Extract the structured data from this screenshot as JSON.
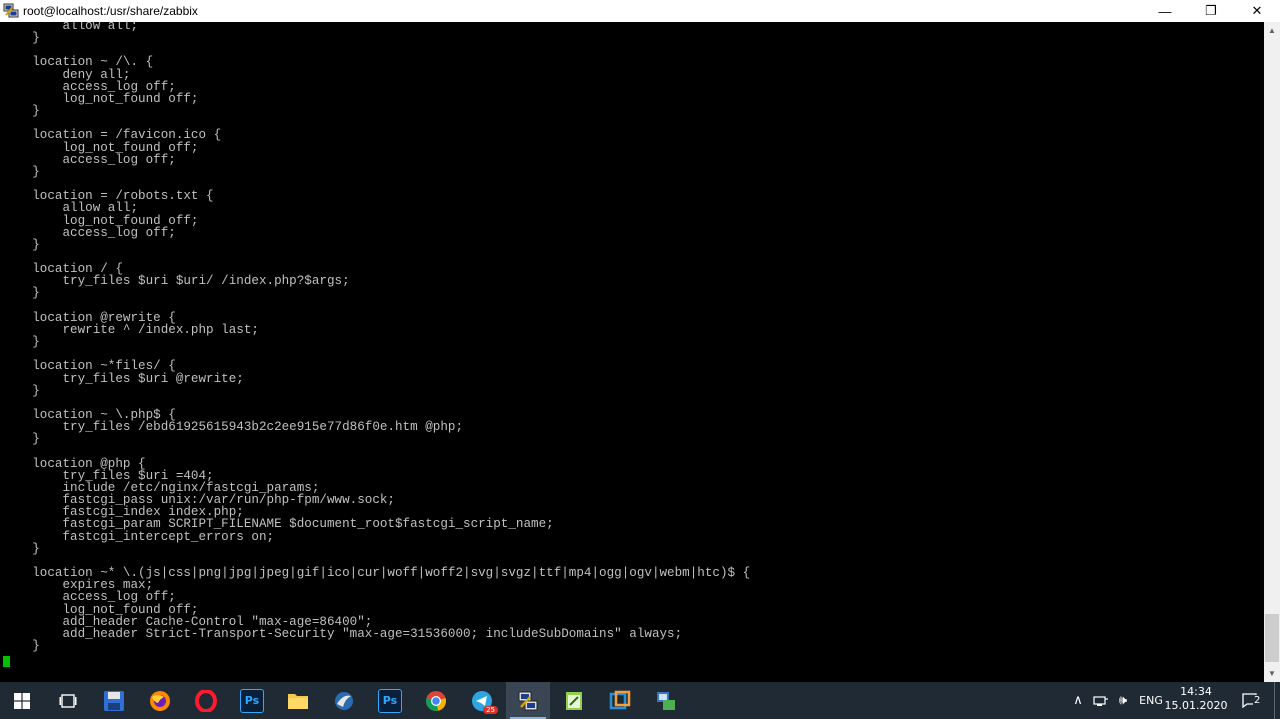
{
  "window": {
    "title": "root@localhost:/usr/share/zabbix",
    "minimize_glyph": "—",
    "maximize_glyph": "❐",
    "close_glyph": "✕"
  },
  "terminal": {
    "content": "        allow all;\n    }\n\n    location ~ /\\. {\n        deny all;\n        access_log off;\n        log_not_found off;\n    }\n\n    location = /favicon.ico {\n        log_not_found off;\n        access_log off;\n    }\n\n    location = /robots.txt {\n        allow all;\n        log_not_found off;\n        access_log off;\n    }\n\n    location / {\n        try_files $uri $uri/ /index.php?$args;\n    }\n\n    location @rewrite {\n        rewrite ^ /index.php last;\n    }\n\n    location ~*files/ {\n        try_files $uri @rewrite;\n    }\n\n    location ~ \\.php$ {\n        try_files /ebd61925615943b2c2ee915e77d86f0e.htm @php;\n    }\n\n    location @php {\n        try_files $uri =404;\n        include /etc/nginx/fastcgi_params;\n        fastcgi_pass unix:/var/run/php-fpm/www.sock;\n        fastcgi_index index.php;\n        fastcgi_param SCRIPT_FILENAME $document_root$fastcgi_script_name;\n        fastcgi_intercept_errors on;\n    }\n\n    location ~* \\.(js|css|png|jpg|jpeg|gif|ico|cur|woff|woff2|svg|svgz|ttf|mp4|ogg|ogv|webm|htc)$ {\n        expires max;\n        access_log off;\n        log_not_found off;\n        add_header Cache-Control \"max-age=86400\";\n        add_header Strict-Transport-Security \"max-age=31536000; includeSubDomains\" always;\n    }\n",
    "text_color": "#c0c0c0",
    "cursor_color": "#00c000"
  },
  "scrollbar": {
    "up_glyph": "▲",
    "down_glyph": "▼"
  },
  "taskbar": {
    "photoshop_label": "Ps",
    "photoshop2_label": "Ps",
    "telegram_badge": "25"
  },
  "tray": {
    "chevron_glyph": "∧",
    "language": "ENG",
    "volume_glyph": "🕪",
    "time": "14:34",
    "date": "15.01.2020",
    "notification_count": "2"
  }
}
